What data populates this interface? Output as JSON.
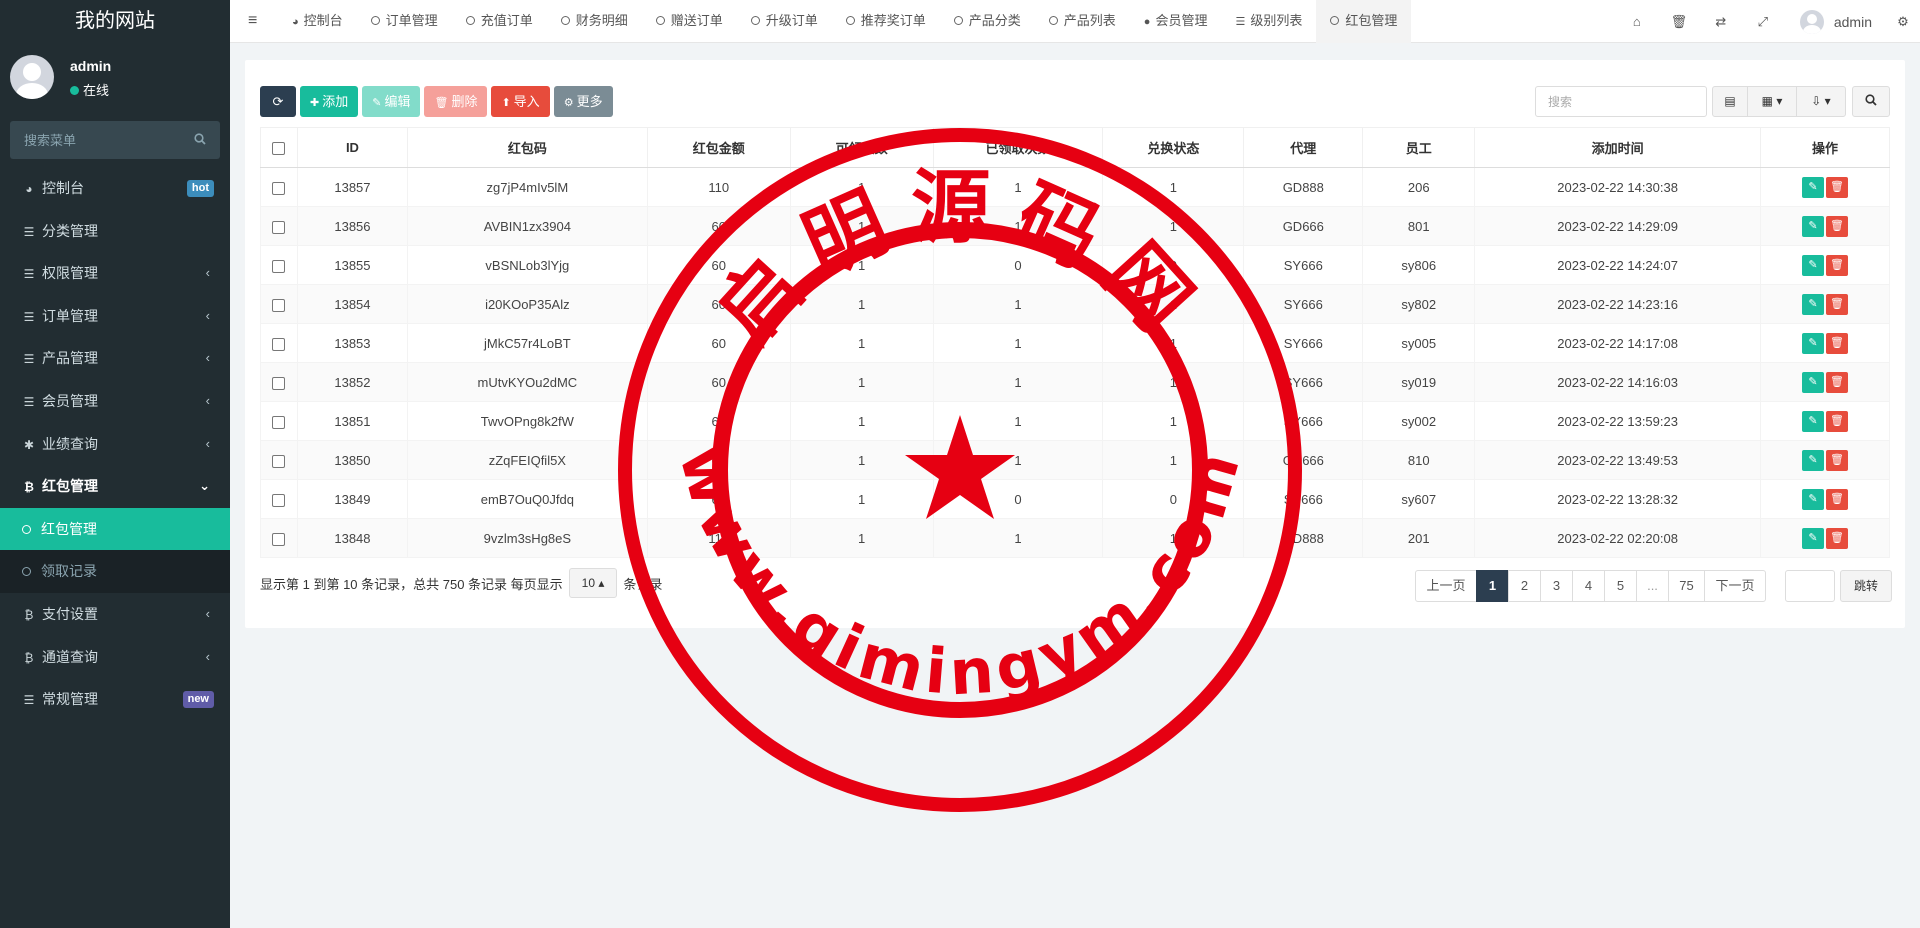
{
  "sidebar": {
    "site_title": "我的网站",
    "user_name": "admin",
    "user_status": "在线",
    "search_placeholder": "搜索菜单",
    "menu": [
      {
        "label": "控制台",
        "badge": "hot",
        "badge_color": "#3c8dbc"
      },
      {
        "label": "分类管理"
      },
      {
        "label": "权限管理"
      },
      {
        "label": "订单管理"
      },
      {
        "label": "产品管理"
      },
      {
        "label": "会员管理"
      },
      {
        "label": "业绩查询"
      },
      {
        "label": "红包管理"
      },
      {
        "label": "红包管理"
      },
      {
        "label": "领取记录"
      },
      {
        "label": "支付设置"
      },
      {
        "label": "通道查询"
      },
      {
        "label": "常规管理",
        "badge": "new",
        "badge_color": "#605ca8"
      }
    ]
  },
  "topbar": {
    "tabs": [
      "控制台",
      "订单管理",
      "充值订单",
      "财务明细",
      "赠送订单",
      "升级订单",
      "推荐奖订单",
      "产品分类",
      "产品列表",
      "会员管理",
      "级别列表",
      "红包管理"
    ],
    "user_name": "admin"
  },
  "toolbar": {
    "add": "添加",
    "edit": "编辑",
    "delete": "删除",
    "import": "导入",
    "more": "更多",
    "search_placeholder": "搜索"
  },
  "table": {
    "columns": [
      "ID",
      "红包码",
      "红包金额",
      "可领次数",
      "已领取次数",
      "兑换状态",
      "代理",
      "员工",
      "添加时间",
      "操作"
    ],
    "rows": [
      [
        "13857",
        "zg7jP4mIv5lM",
        "110",
        "1",
        "1",
        "1",
        "GD888",
        "206",
        "2023-02-22 14:30:38"
      ],
      [
        "13856",
        "AVBIN1zx3904",
        "60",
        "1",
        "1",
        "1",
        "GD666",
        "801",
        "2023-02-22 14:29:09"
      ],
      [
        "13855",
        "vBSNLob3lYjg",
        "60",
        "1",
        "0",
        "0",
        "SY666",
        "sy806",
        "2023-02-22 14:24:07"
      ],
      [
        "13854",
        "i20KOoP35Alz",
        "60",
        "1",
        "1",
        "1",
        "SY666",
        "sy802",
        "2023-02-22 14:23:16"
      ],
      [
        "13853",
        "jMkC57r4LoBT",
        "60",
        "1",
        "1",
        "1",
        "SY666",
        "sy005",
        "2023-02-22 14:17:08"
      ],
      [
        "13852",
        "mUtvKYOu2dMC",
        "60",
        "1",
        "1",
        "1",
        "SY666",
        "sy019",
        "2023-02-22 14:16:03"
      ],
      [
        "13851",
        "TwvOPng8k2fW",
        "60",
        "1",
        "1",
        "1",
        "SY666",
        "sy002",
        "2023-02-22 13:59:23"
      ],
      [
        "13850",
        "zZqFEIQfil5X",
        "60",
        "1",
        "1",
        "1",
        "GD666",
        "810",
        "2023-02-22 13:49:53"
      ],
      [
        "13849",
        "emB7OuQ0Jfdq",
        "60",
        "1",
        "0",
        "0",
        "SY666",
        "sy607",
        "2023-02-22 13:28:32"
      ],
      [
        "13848",
        "9vzlm3sHg8eS",
        "110",
        "1",
        "1",
        "1",
        "GD888",
        "201",
        "2023-02-22 02:20:08"
      ]
    ]
  },
  "footer": {
    "info_prefix": "显示第 1 到第 10 条记录，总共 750 条记录 每页显示",
    "page_size": "10",
    "info_suffix": "条记录",
    "pages": [
      "上一页",
      "1",
      "2",
      "3",
      "4",
      "5",
      "...",
      "75",
      "下一页"
    ],
    "jump": "跳转"
  },
  "watermark": {
    "top_text": "启明源码网",
    "bottom_text": "www.qimingym.com",
    "color": "#e60012"
  },
  "colors": {
    "sidebar_bg": "#222d32",
    "accent": "#18bc9c",
    "danger": "#e74c3c",
    "primary_dark": "#2c3e50"
  }
}
